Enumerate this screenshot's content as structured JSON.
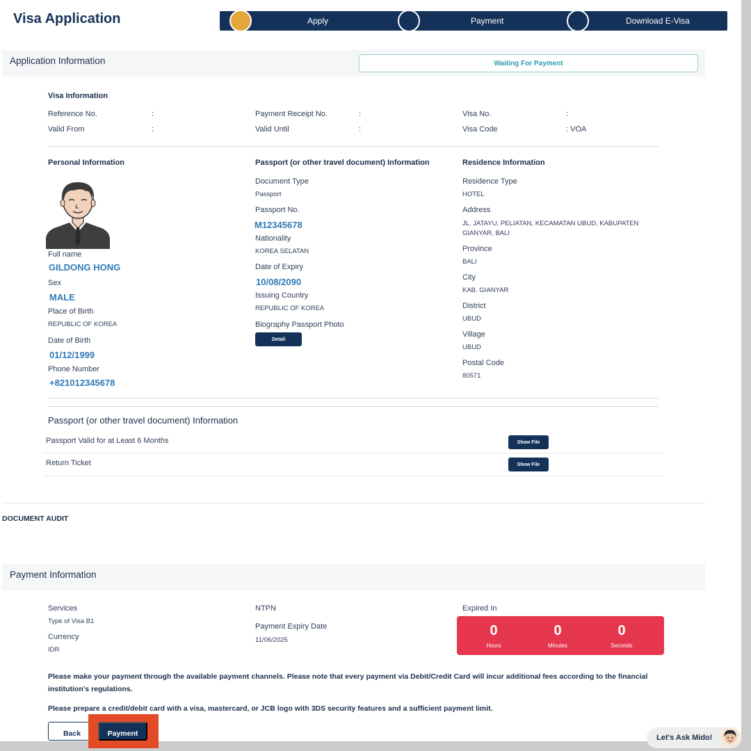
{
  "header": {
    "title": "Visa Application"
  },
  "stepper": {
    "steps": [
      "Apply",
      "Payment",
      "Download E-Visa"
    ]
  },
  "application": {
    "title": "Application Information",
    "status": "Waiting For Payment",
    "visa_info": {
      "heading": "Visa Information",
      "reference_no_label": "Reference No.",
      "reference_no_value": "",
      "payment_receipt_label": "Payment Receipt No.",
      "payment_receipt_value": "",
      "visa_no_label": "Visa No.",
      "visa_no_value": "",
      "valid_from_label": "Valid From",
      "valid_from_value": "",
      "valid_until_label": "Valid Until",
      "valid_until_value": "",
      "visa_code_label": "Visa Code",
      "visa_code_value": "VOA"
    },
    "personal": {
      "heading": "Personal Information",
      "full_name_label": "Full name",
      "full_name": "GILDONG HONG",
      "sex_label": "Sex",
      "sex": "MALE",
      "pob_label": "Place of Birth",
      "pob": "REPUBLIC OF KOREA",
      "dob_label": "Date of Birth",
      "dob": "01/12/1999",
      "phone_label": "Phone Number",
      "phone": "+821012345678"
    },
    "passport": {
      "heading": "Passport (or other travel document) Information",
      "doc_type_label": "Document Type",
      "doc_type": "Passport",
      "passport_no_label": "Passport No.",
      "passport_no": "M12345678",
      "nationality_label": "Nationality",
      "nationality": "KOREA SELATAN",
      "expiry_label": "Date of Expiry",
      "expiry": "10/08/2090",
      "issuing_label": "Issuing Country",
      "issuing": "REPUBLIC OF KOREA",
      "photo_label": "Biography Passport Photo",
      "detail_button": "Detail"
    },
    "residence": {
      "heading": "Residence Information",
      "type_label": "Residence Type",
      "type": "HOTEL",
      "address_label": "Address",
      "address": "JL. JATAYU, PELIATAN, KECAMATAN UBUD, KABUPATEN GIANYAR, BALI",
      "province_label": "Province",
      "province": "BALI",
      "city_label": "City",
      "city": "KAB. GIANYAR",
      "district_label": "District",
      "district": "UBUD",
      "village_label": "Village",
      "village": "UBUD",
      "postal_label": "Postal Code",
      "postal": "80571"
    },
    "documents": {
      "heading": "Passport (or other travel document) Information",
      "rows": [
        {
          "label": "Passport Valid for at Least 6 Months",
          "button": "Show File"
        },
        {
          "label": "Return Ticket",
          "button": "Show File"
        }
      ]
    }
  },
  "audit": {
    "title": "DOCUMENT AUDIT"
  },
  "payment": {
    "title": "Payment Information",
    "services_label": "Services",
    "services": "Type of Visa B1",
    "currency_label": "Currency",
    "currency": "IDR",
    "ntpn_label": "NTPN",
    "expiry_date_label": "Payment Expiry Date",
    "expiry_date": "11/06/2025",
    "expired_in_label": "Expired In",
    "timer": {
      "hours": "0",
      "hours_label": "Hours",
      "minutes": "0",
      "minutes_label": "Minutes",
      "seconds": "0",
      "seconds_label": "Seconds"
    },
    "notice1": "Please make your payment through the available payment channels. Please note that every payment via Debit/Credit Card will incur additional fees according to the financial institution’s regulations.",
    "notice2": "Please prepare a credit/debit card with a visa, mastercard, or JCB logo with 3DS security features and a sufficient payment limit.",
    "back_button": "Back",
    "payment_button": "Payment"
  },
  "chat": {
    "label": "Let's Ask Mido!"
  },
  "colors": {
    "primary": "#143259",
    "accent": "#e4a53a",
    "timer": "#e6374f",
    "link": "#2f7ab8",
    "highlight": "#e24b26"
  }
}
